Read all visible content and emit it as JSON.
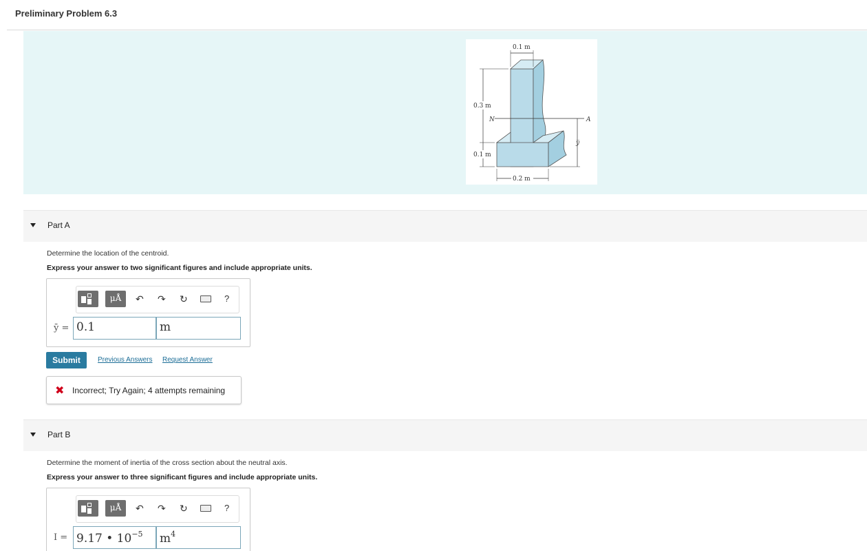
{
  "page": {
    "title": "Preliminary Problem 6.3"
  },
  "figure": {
    "dim_top": "0.1 m",
    "dim_height": "0.3 m",
    "dim_base": "0.1 m",
    "dim_width": "0.2 m",
    "label_n": "N",
    "label_a": "A",
    "label_ybar": "y̅"
  },
  "partA": {
    "label": "Part A",
    "question": "Determine the location of the centroid.",
    "instruction": "Express your answer to two significant figures and include appropriate units.",
    "toolbar": {
      "mu_label": "μÅ",
      "help_label": "?"
    },
    "equation_label": "ȳ =",
    "value": "0.1",
    "unit": "m",
    "submit_label": "Submit",
    "prev_answers_label": "Previous Answers",
    "request_answer_label": "Request Answer",
    "feedback": "Incorrect; Try Again; 4 attempts remaining"
  },
  "partB": {
    "label": "Part B",
    "question": "Determine the moment of inertia of the cross section about the neutral axis.",
    "instruction": "Express your answer to three significant figures and include appropriate units.",
    "toolbar": {
      "mu_label": "μÅ",
      "help_label": "?"
    },
    "equation_label": "I =",
    "value_mantissa": "9.17 • 10",
    "value_exponent": "−5",
    "unit_base": "m",
    "unit_exponent": "4"
  },
  "colors": {
    "band": "#e6f6f7",
    "accent": "#2a7ba0",
    "error": "#d0021b",
    "shape_fill": "#b9dbe9"
  }
}
